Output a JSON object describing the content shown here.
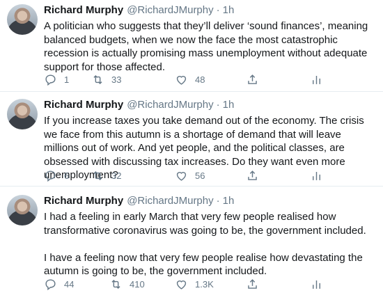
{
  "icons": {
    "reply": "reply-icon",
    "retweet": "retweet-icon",
    "like": "heart-icon",
    "share": "share-icon",
    "analytics": "analytics-icon"
  },
  "colors": {
    "text": "#14171a",
    "muted": "#657786",
    "divider": "#e6ecf0"
  },
  "tweets": [
    {
      "name": "Richard Murphy",
      "handle": "@RichardJMurphy",
      "dot": "·",
      "time": "1h",
      "text": "A politician who suggests that they’ll deliver ‘sound finances’, meaning balanced budgets, when we now the face the most catastrophic recession is actually promising mass unemployment without adequate support for those affected.",
      "replies": "1",
      "retweets": "33",
      "likes": "48"
    },
    {
      "name": "Richard Murphy",
      "handle": "@RichardJMurphy",
      "dot": "·",
      "time": "1h",
      "text": "If you increase taxes you take demand out of the economy. The crisis we face from this autumn is a shortage of demand that will leave millions out of work. And yet people, and the political classes, are obsessed with discussing tax increases. Do they want even more unemployment?",
      "replies": "6",
      "retweets": "32",
      "likes": "56"
    },
    {
      "name": "Richard Murphy",
      "handle": "@RichardJMurphy",
      "dot": "·",
      "time": "1h",
      "text": "I had a feeling in early March that very few people realised how transformative coronavirus was going to be, the government included.\n\nI have a feeling now that very few people realise how devastating the autumn is going to be, the government included.",
      "replies": "44",
      "retweets": "410",
      "likes": "1.3K"
    }
  ]
}
